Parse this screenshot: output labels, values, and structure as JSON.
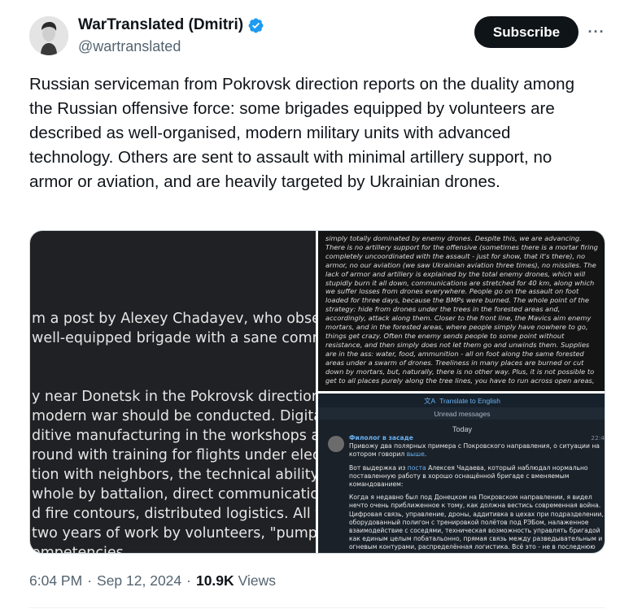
{
  "author": {
    "display_name": "WarTranslated (Dmitri)",
    "handle": "@wartranslated",
    "verified_icon": "verified-badge-icon",
    "verified_color": "#1d9bf0"
  },
  "actions": {
    "subscribe_label": "Subscribe",
    "more_label": "···"
  },
  "tweet": {
    "text": "Russian serviceman from Pokrovsk direction reports on the duality among the Russian offensive force: some brigades equipped by volunteers are described as well-organised, modern military units with advanced technology. Others are sent to assault with minimal artillery support, no armor or aviation, and are heavily targeted by Ukrainian drones."
  },
  "media": {
    "left_image": {
      "lines_top": [
        "m a post by Alexey Chadayev, who observ",
        " well-equipped brigade with a sane comm"
      ],
      "lines_bottom": [
        "y near Donetsk in the Pokrovsk direction, I",
        " modern war should be conducted. Digita",
        "ditive manufacturing in the workshops at t",
        "round with training for flights under electr",
        "tion with neighbors, the technical ability to",
        " whole by battalion, direct communication",
        "d fire contours, distributed logistics. All th",
        " two years of work by volunteers, \"pumpin",
        "ompetencies."
      ]
    },
    "top_right_image": {
      "text": "simply totally dominated by enemy drones. Despite this, we are advancing. There is no artillery support for the offensive (sometimes there is a mortar firing completely uncoordinated with the assault - just for show, that it's there), no armor, no our aviation (we saw Ukrainian aviation three times), no missiles. The lack of armor and artillery is explained by the total enemy drones, which will stupidly burn it all down, communications are stretched for 40 km, along which we suffer losses from drones everywhere. People go on the assault on foot loaded for three days, because the BMPs were burned. The whole point of the strategy: hide from drones under the trees in the forested areas and, accordingly, attack along them. Closer to the front line, the Mavics aim enemy mortars, and in the forested areas, where people simply have nowhere to go, things get crazy. Often the enemy sends people to some point without resistance, and then simply does not let them go and unwinds them. Supplies are in the ass: water, food, ammunition - all on foot along the same forested areas under a swarm of drones. Treeliness in many places are burned or cut down by mortars, but, naturally, there is no other way. Plus, it is not possible to get to all places purely along the tree lines, you have to run across open areas,"
    },
    "bottom_right_image": {
      "translate_label": "Translate to English",
      "unread_label": "Unread messages",
      "today_label": "Today",
      "sender": "Филолог в засаде",
      "time": "22:4",
      "para1_a": "Привожу два полярных примера с Покровского направления, о ситуации на котором говорил ",
      "para1_link": "выше",
      "para1_b": ".",
      "para2_a": "Вот выдержка из ",
      "para2_link": "поста",
      "para2_b": " Алексея Чадаева, который наблюдал нормально поставленную работу в хорошо оснащённой бригаде с вменяемым командованием:",
      "para3": "Когда я недавно был под Донецком на Покровском направлении, я видел нечто очень приближенное к тому, как должна вестись современная война. Цифровая связь, управление, дроны, аддитивка в цехах при подразделении, оборудованный полигон с тренировкой полётов под РЭБом, налаженное взаимодействие с соседями, техническая возможность управлять бригадой как единым целым побатальонно, прямая связь между разведывательным и огневым контурами, распределённая логистика. Всё это - не в последнюю"
    }
  },
  "meta": {
    "time": "6:04 PM",
    "separator": "·",
    "date": "Sep 12, 2024",
    "views_count": "10.9K",
    "views_label": "Views"
  }
}
